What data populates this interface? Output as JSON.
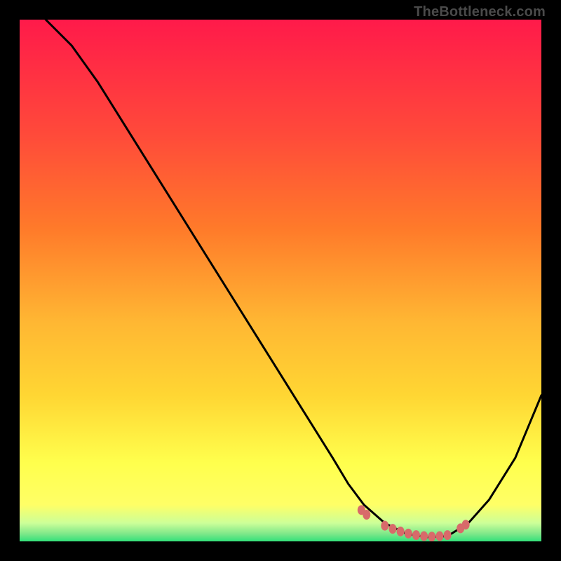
{
  "watermark": "TheBottleneck.com",
  "chart_data": {
    "type": "line",
    "title": "",
    "xlabel": "",
    "ylabel": "",
    "xlim": [
      0,
      100
    ],
    "ylim": [
      0,
      100
    ],
    "gradient_colors": {
      "top": "#ff1a4a",
      "upper_mid": "#ff7a2a",
      "mid": "#ffd633",
      "lower_mid": "#ffff66",
      "bottom_band": "#ccff99",
      "bottom_edge": "#33e07a"
    },
    "series": [
      {
        "name": "curve",
        "type": "line",
        "color": "#000000",
        "x": [
          5,
          10,
          15,
          20,
          25,
          30,
          35,
          40,
          45,
          50,
          55,
          60,
          63,
          66,
          70,
          74,
          78,
          82,
          86,
          90,
          95,
          100
        ],
        "y": [
          100,
          95,
          88,
          80,
          72,
          64,
          56,
          48,
          40,
          32,
          24,
          16,
          11,
          7,
          3.5,
          1.5,
          0.8,
          1.0,
          3.5,
          8,
          16,
          28
        ]
      }
    ],
    "dotted_markers": {
      "color": "#d86a6a",
      "points": [
        {
          "x": 65.5,
          "y": 6.0
        },
        {
          "x": 66.5,
          "y": 5.1
        },
        {
          "x": 70,
          "y": 3.0
        },
        {
          "x": 71.5,
          "y": 2.4
        },
        {
          "x": 73,
          "y": 1.9
        },
        {
          "x": 74.5,
          "y": 1.5
        },
        {
          "x": 76,
          "y": 1.2
        },
        {
          "x": 77.5,
          "y": 1.0
        },
        {
          "x": 79,
          "y": 0.9
        },
        {
          "x": 80.5,
          "y": 1.0
        },
        {
          "x": 82,
          "y": 1.2
        },
        {
          "x": 84.5,
          "y": 2.5
        },
        {
          "x": 85.5,
          "y": 3.2
        }
      ]
    }
  }
}
